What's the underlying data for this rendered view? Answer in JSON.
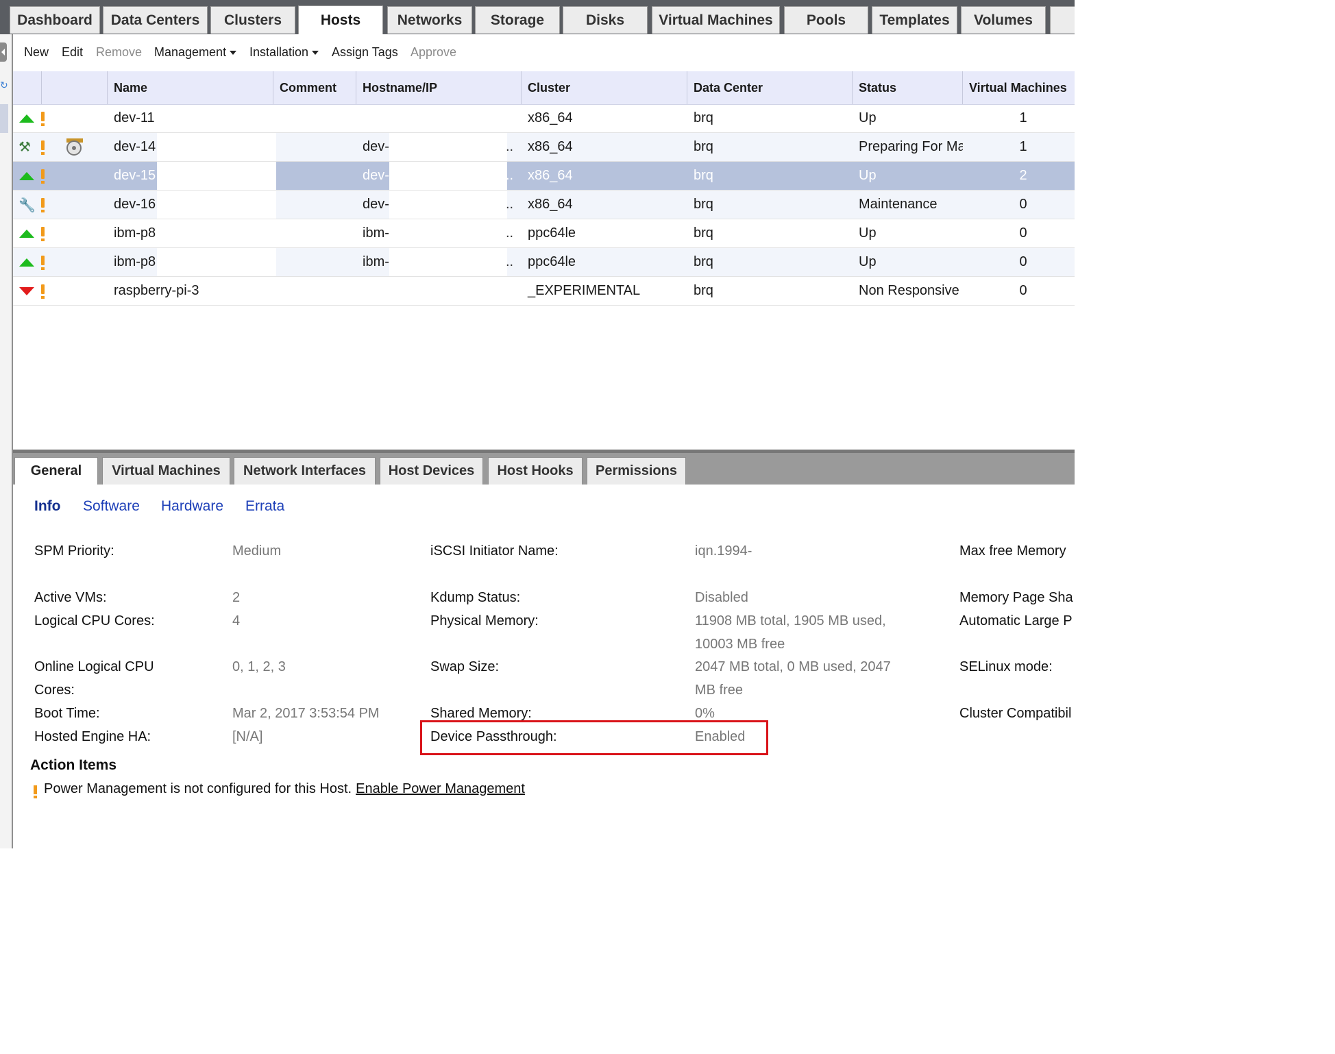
{
  "top_tabs": [
    "Dashboard",
    "Data Centers",
    "Clusters",
    "Hosts",
    "Networks",
    "Storage",
    "Disks",
    "Virtual Machines",
    "Pools",
    "Templates",
    "Volumes"
  ],
  "actions": {
    "new": "New",
    "edit": "Edit",
    "remove": "Remove",
    "management": "Management",
    "installation": "Installation",
    "assign_tags": "Assign Tags",
    "approve": "Approve"
  },
  "columns": {
    "name": "Name",
    "comment": "Comment",
    "hostname": "Hostname/IP",
    "cluster": "Cluster",
    "datacenter": "Data Center",
    "status": "Status",
    "vms": "Virtual Machines"
  },
  "hosts": [
    {
      "name": "dev-11",
      "hostname": "",
      "cluster": "x86_64",
      "datacenter": "brq",
      "status": "Up",
      "vms": "1",
      "icon": "up-arrow-icon"
    },
    {
      "name": "dev-14",
      "hostname": "dev-",
      "cluster": "x86_64",
      "datacenter": "brq",
      "status": "Preparing For Ma",
      "vms": "1",
      "icon": "preparing-maintenance-icon"
    },
    {
      "name": "dev-15",
      "hostname": "dev-",
      "cluster": "x86_64",
      "datacenter": "brq",
      "status": "Up",
      "vms": "2",
      "icon": "up-arrow-icon"
    },
    {
      "name": "dev-16",
      "hostname": "dev-",
      "cluster": "x86_64",
      "datacenter": "brq",
      "status": "Maintenance",
      "vms": "0",
      "icon": "wrench-icon"
    },
    {
      "name": "ibm-p8",
      "hostname": "ibm-",
      "cluster": "ppc64le",
      "datacenter": "brq",
      "status": "Up",
      "vms": "0",
      "icon": "up-arrow-icon"
    },
    {
      "name": "ibm-p8",
      "hostname": "ibm-",
      "cluster": "ppc64le",
      "datacenter": "brq",
      "status": "Up",
      "vms": "0",
      "icon": "up-arrow-icon"
    },
    {
      "name": "raspberry-pi-3",
      "hostname": "",
      "cluster": "_EXPERIMENTAL",
      "datacenter": "brq",
      "status": "Non Responsive",
      "vms": "0",
      "icon": "down-arrow-icon"
    }
  ],
  "ellipsis": "..",
  "sub_tabs": [
    "General",
    "Virtual Machines",
    "Network Interfaces",
    "Host Devices",
    "Host Hooks",
    "Permissions"
  ],
  "info_tabs": [
    "Info",
    "Software",
    "Hardware",
    "Errata"
  ],
  "details": {
    "spm_priority_label": "SPM Priority:",
    "spm_priority": "Medium",
    "active_vms_label": "Active VMs:",
    "active_vms": "2",
    "logical_cpu_label": "Logical CPU Cores:",
    "logical_cpu": "4",
    "online_cpu_label_1": "Online Logical CPU",
    "online_cpu_label_2": "Cores:",
    "online_cpu": "0, 1, 2, 3",
    "boot_time_label": "Boot Time:",
    "boot_time": "Mar 2, 2017 3:53:54 PM",
    "hosted_engine_label": "Hosted Engine HA:",
    "hosted_engine": "[N/A]",
    "iscsi_label": "iSCSI Initiator Name:",
    "iscsi": "iqn.1994-",
    "kdump_label": "Kdump Status:",
    "kdump": "Disabled",
    "phys_mem_label": "Physical Memory:",
    "phys_mem_1": "11908 MB total, 1905 MB used,",
    "phys_mem_2": "10003 MB free",
    "swap_label": "Swap Size:",
    "swap_1": "2047 MB total, 0 MB used, 2047",
    "swap_2": "MB free",
    "shared_mem_label": "Shared Memory:",
    "shared_mem": "0%",
    "passthrough_label": "Device Passthrough:",
    "passthrough": "Enabled",
    "max_free_mem_label": "Max free Memory",
    "mem_page_label": "Memory Page Sha",
    "auto_large_label": "Automatic Large P",
    "selinux_label": "SELinux mode:",
    "cluster_compat_label": "Cluster Compatibil"
  },
  "action_items": {
    "title": "Action Items",
    "message": "Power Management is not configured for this Host.",
    "link": "Enable Power Management"
  },
  "colors": {
    "accent_highlight": "#d9141a",
    "selected_row": "#b6c2dc",
    "header_bg": "#e8eafa",
    "status_up": "#1dbb1d",
    "status_down": "#e21c1c"
  }
}
